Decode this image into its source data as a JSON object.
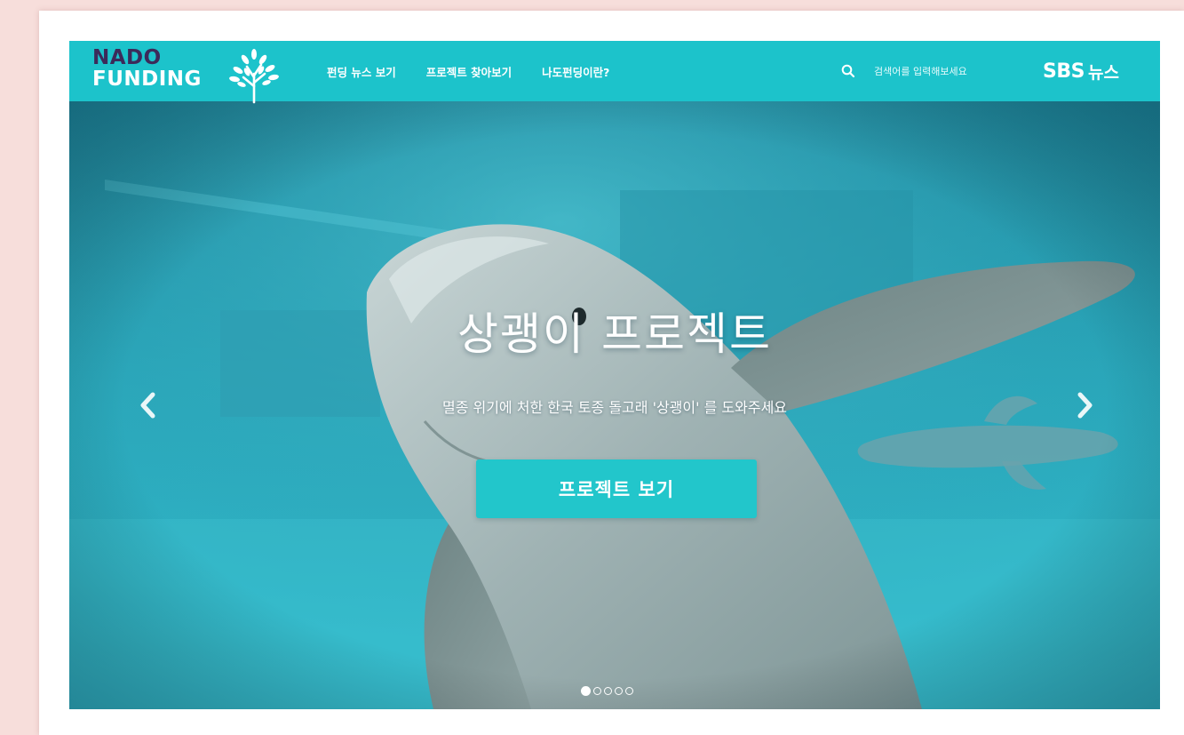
{
  "header": {
    "logo": {
      "line1": "NADO",
      "line2": "FUNDING"
    },
    "nav": [
      {
        "label": "펀딩 뉴스 보기"
      },
      {
        "label": "프로젝트 찾아보기"
      },
      {
        "label": "나도펀딩이란?"
      }
    ],
    "search": {
      "placeholder": "검색어를 입력해보세요"
    },
    "partner": {
      "brand": "SBS",
      "suffix": "뉴스"
    }
  },
  "hero": {
    "title": "상괭이 프로젝트",
    "subtitle": "멸종 위기에 처한 한국 토종 돌고래 '상괭이' 를 도와주세요",
    "cta_label": "프로젝트 보기",
    "slides_total": 5,
    "active_slide": 1
  },
  "colors": {
    "header_bg": "#1cc3cb",
    "logo_dark": "#3c2a5a",
    "cta_bg": "#22c6cb",
    "page_bg": "#f7dedb"
  }
}
